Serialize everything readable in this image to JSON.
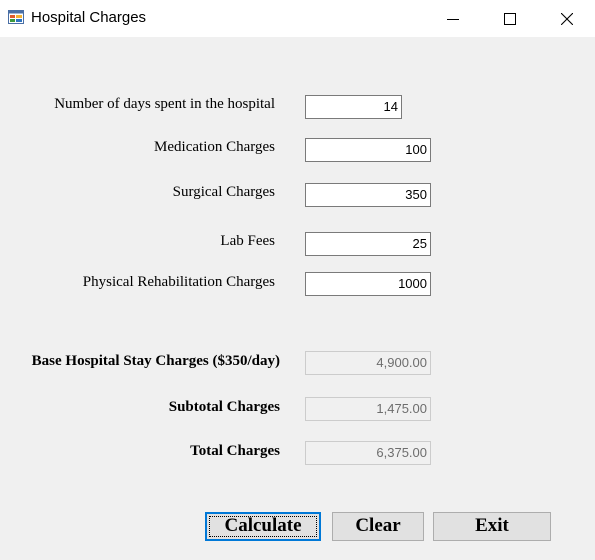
{
  "window": {
    "title": "Hospital Charges",
    "icon": "app-form-icon",
    "controls": {
      "minimize_icon": "minimize-icon",
      "maximize_icon": "maximize-icon",
      "close_icon": "close-icon"
    }
  },
  "inputs": {
    "days": {
      "label": "Number of days spent in the hospital",
      "value": "14"
    },
    "medication": {
      "label": "Medication Charges",
      "value": "100"
    },
    "surgical": {
      "label": "Surgical Charges",
      "value": "350"
    },
    "lab": {
      "label": "Lab Fees",
      "value": "25"
    },
    "rehab": {
      "label": "Physical Rehabilitation Charges",
      "value": "1000"
    }
  },
  "outputs": {
    "base": {
      "label": "Base Hospital Stay Charges ($350/day)",
      "value": "4,900.00"
    },
    "subtotal": {
      "label": "Subtotal Charges",
      "value": "1,475.00"
    },
    "total": {
      "label": "Total Charges",
      "value": "6,375.00"
    }
  },
  "buttons": {
    "calculate": "Calculate",
    "clear": "Clear",
    "exit": "Exit"
  },
  "colors": {
    "background": "#f0f0f0",
    "accent": "#0078d7"
  }
}
